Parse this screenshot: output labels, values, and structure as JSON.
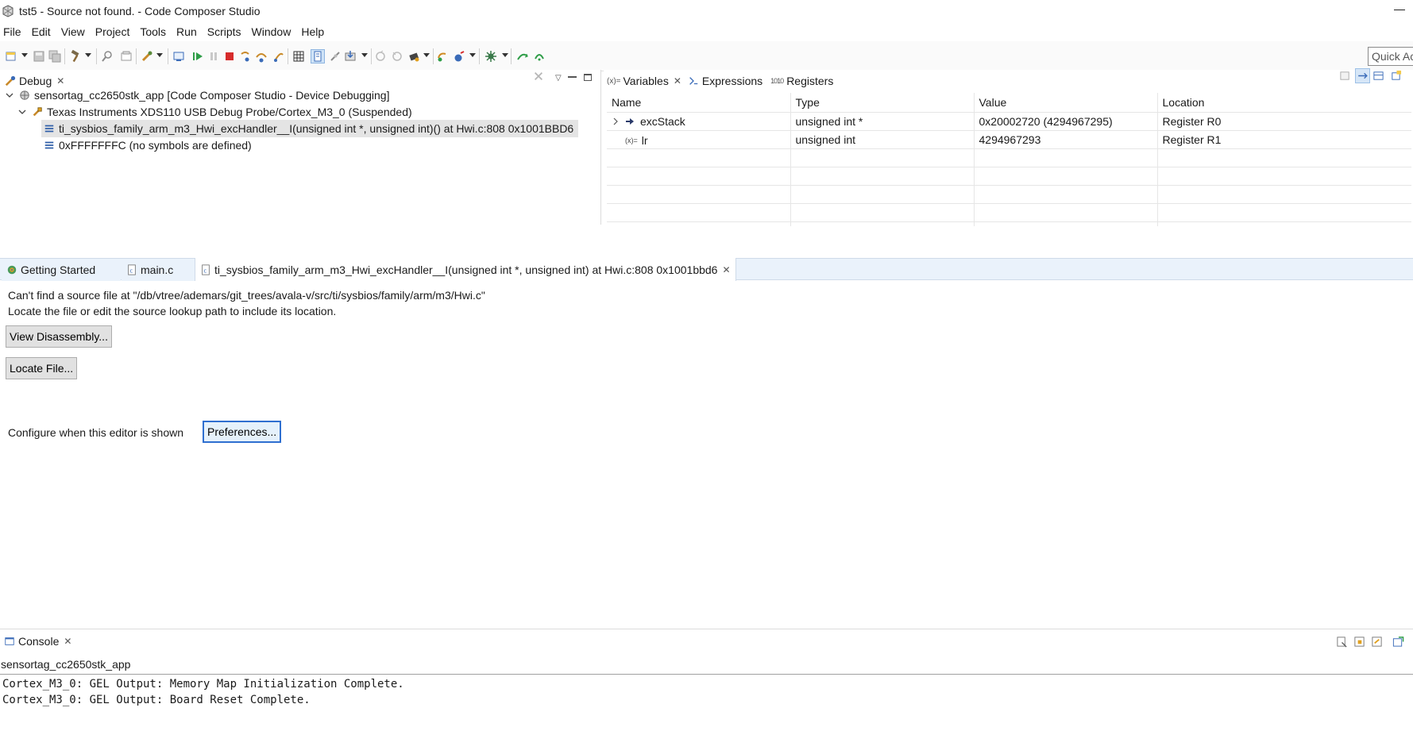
{
  "window": {
    "title": "tst5 - Source not found. - Code Composer Studio"
  },
  "menu": [
    "File",
    "Edit",
    "View",
    "Project",
    "Tools",
    "Run",
    "Scripts",
    "Window",
    "Help"
  ],
  "toolbar": {
    "quick_access_placeholder": "Quick Access"
  },
  "debug_view": {
    "tab_label": "Debug",
    "tree": [
      {
        "label": "sensortag_cc2650stk_app [Code Composer Studio - Device Debugging]",
        "icon": "debug-launch-icon"
      },
      {
        "label": "Texas Instruments XDS110 USB Debug Probe/Cortex_M3_0 (Suspended)",
        "icon": "debug-target-icon"
      },
      {
        "label": "ti_sysbios_family_arm_m3_Hwi_excHandler__I(unsigned int *, unsigned int)() at Hwi.c:808 0x1001BBD6",
        "icon": "stack-frame-icon"
      },
      {
        "label": "0xFFFFFFFC  (no symbols are defined)",
        "icon": "stack-frame-icon"
      }
    ]
  },
  "variables_view": {
    "tabs": [
      "Variables",
      "Expressions",
      "Registers"
    ],
    "columns": [
      "Name",
      "Type",
      "Value",
      "Location"
    ],
    "rows": [
      {
        "name": "excStack",
        "type": "unsigned int *",
        "value": "0x20002720 (4294967295)",
        "location": "Register R0"
      },
      {
        "name": "lr",
        "type": "unsigned int",
        "value": "4294967293",
        "location": "Register R1"
      }
    ]
  },
  "editor": {
    "tabs": [
      "Getting Started",
      "main.c",
      "ti_sysbios_family_arm_m3_Hwi_excHandler__I(unsigned int *, unsigned int) at Hwi.c:808 0x1001bbd6"
    ],
    "message_line1": "Can't find a source file at \"/db/vtree/ademars/git_trees/avala-v/src/ti/sysbios/family/arm/m3/Hwi.c\"",
    "message_line2": "Locate the file or edit the source lookup path to include its location.",
    "view_disassembly_label": "View Disassembly...",
    "locate_file_label": "Locate File...",
    "configure_label": "Configure when this editor is shown",
    "preferences_label": "Preferences..."
  },
  "console": {
    "tab_label": "Console",
    "session": "sensortag_cc2650stk_app",
    "lines": [
      "Cortex_M3_0: GEL Output: Memory Map Initialization Complete.",
      "Cortex_M3_0: GEL Output: Board Reset Complete."
    ]
  },
  "colors": {
    "accent": "#2f6fd0",
    "selection": "#e4e4e4",
    "stop": "#d62b2b",
    "resume": "#2e9d47"
  }
}
